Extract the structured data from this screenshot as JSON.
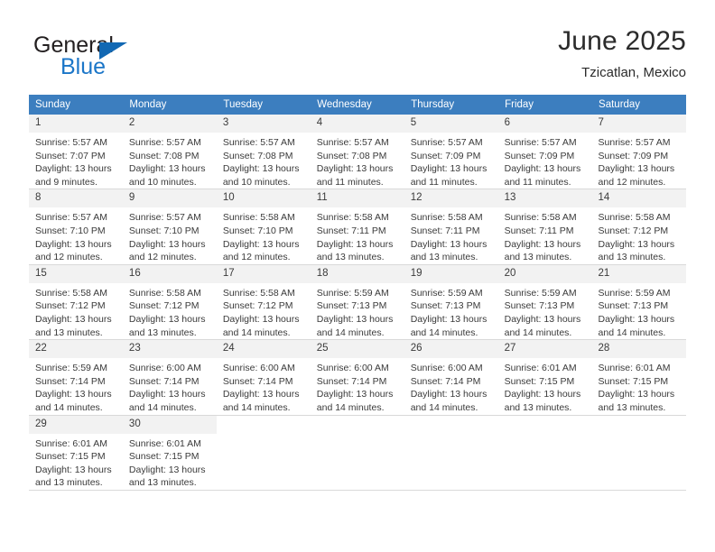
{
  "brand": {
    "name_top": "General",
    "name_bottom": "Blue",
    "accent_color": "#1b76c8",
    "triangle_color": "#1268b3"
  },
  "header": {
    "title": "June 2025",
    "subtitle": "Tzicatlan, Mexico"
  },
  "calendar": {
    "header_bg": "#3c7ebf",
    "weekdays": [
      "Sunday",
      "Monday",
      "Tuesday",
      "Wednesday",
      "Thursday",
      "Friday",
      "Saturday"
    ],
    "weeks": [
      [
        {
          "day": "1",
          "sunrise": "Sunrise: 5:57 AM",
          "sunset": "Sunset: 7:07 PM",
          "daylight_1": "Daylight: 13 hours",
          "daylight_2": "and 9 minutes."
        },
        {
          "day": "2",
          "sunrise": "Sunrise: 5:57 AM",
          "sunset": "Sunset: 7:08 PM",
          "daylight_1": "Daylight: 13 hours",
          "daylight_2": "and 10 minutes."
        },
        {
          "day": "3",
          "sunrise": "Sunrise: 5:57 AM",
          "sunset": "Sunset: 7:08 PM",
          "daylight_1": "Daylight: 13 hours",
          "daylight_2": "and 10 minutes."
        },
        {
          "day": "4",
          "sunrise": "Sunrise: 5:57 AM",
          "sunset": "Sunset: 7:08 PM",
          "daylight_1": "Daylight: 13 hours",
          "daylight_2": "and 11 minutes."
        },
        {
          "day": "5",
          "sunrise": "Sunrise: 5:57 AM",
          "sunset": "Sunset: 7:09 PM",
          "daylight_1": "Daylight: 13 hours",
          "daylight_2": "and 11 minutes."
        },
        {
          "day": "6",
          "sunrise": "Sunrise: 5:57 AM",
          "sunset": "Sunset: 7:09 PM",
          "daylight_1": "Daylight: 13 hours",
          "daylight_2": "and 11 minutes."
        },
        {
          "day": "7",
          "sunrise": "Sunrise: 5:57 AM",
          "sunset": "Sunset: 7:09 PM",
          "daylight_1": "Daylight: 13 hours",
          "daylight_2": "and 12 minutes."
        }
      ],
      [
        {
          "day": "8",
          "sunrise": "Sunrise: 5:57 AM",
          "sunset": "Sunset: 7:10 PM",
          "daylight_1": "Daylight: 13 hours",
          "daylight_2": "and 12 minutes."
        },
        {
          "day": "9",
          "sunrise": "Sunrise: 5:57 AM",
          "sunset": "Sunset: 7:10 PM",
          "daylight_1": "Daylight: 13 hours",
          "daylight_2": "and 12 minutes."
        },
        {
          "day": "10",
          "sunrise": "Sunrise: 5:58 AM",
          "sunset": "Sunset: 7:10 PM",
          "daylight_1": "Daylight: 13 hours",
          "daylight_2": "and 12 minutes."
        },
        {
          "day": "11",
          "sunrise": "Sunrise: 5:58 AM",
          "sunset": "Sunset: 7:11 PM",
          "daylight_1": "Daylight: 13 hours",
          "daylight_2": "and 13 minutes."
        },
        {
          "day": "12",
          "sunrise": "Sunrise: 5:58 AM",
          "sunset": "Sunset: 7:11 PM",
          "daylight_1": "Daylight: 13 hours",
          "daylight_2": "and 13 minutes."
        },
        {
          "day": "13",
          "sunrise": "Sunrise: 5:58 AM",
          "sunset": "Sunset: 7:11 PM",
          "daylight_1": "Daylight: 13 hours",
          "daylight_2": "and 13 minutes."
        },
        {
          "day": "14",
          "sunrise": "Sunrise: 5:58 AM",
          "sunset": "Sunset: 7:12 PM",
          "daylight_1": "Daylight: 13 hours",
          "daylight_2": "and 13 minutes."
        }
      ],
      [
        {
          "day": "15",
          "sunrise": "Sunrise: 5:58 AM",
          "sunset": "Sunset: 7:12 PM",
          "daylight_1": "Daylight: 13 hours",
          "daylight_2": "and 13 minutes."
        },
        {
          "day": "16",
          "sunrise": "Sunrise: 5:58 AM",
          "sunset": "Sunset: 7:12 PM",
          "daylight_1": "Daylight: 13 hours",
          "daylight_2": "and 13 minutes."
        },
        {
          "day": "17",
          "sunrise": "Sunrise: 5:58 AM",
          "sunset": "Sunset: 7:12 PM",
          "daylight_1": "Daylight: 13 hours",
          "daylight_2": "and 14 minutes."
        },
        {
          "day": "18",
          "sunrise": "Sunrise: 5:59 AM",
          "sunset": "Sunset: 7:13 PM",
          "daylight_1": "Daylight: 13 hours",
          "daylight_2": "and 14 minutes."
        },
        {
          "day": "19",
          "sunrise": "Sunrise: 5:59 AM",
          "sunset": "Sunset: 7:13 PM",
          "daylight_1": "Daylight: 13 hours",
          "daylight_2": "and 14 minutes."
        },
        {
          "day": "20",
          "sunrise": "Sunrise: 5:59 AM",
          "sunset": "Sunset: 7:13 PM",
          "daylight_1": "Daylight: 13 hours",
          "daylight_2": "and 14 minutes."
        },
        {
          "day": "21",
          "sunrise": "Sunrise: 5:59 AM",
          "sunset": "Sunset: 7:13 PM",
          "daylight_1": "Daylight: 13 hours",
          "daylight_2": "and 14 minutes."
        }
      ],
      [
        {
          "day": "22",
          "sunrise": "Sunrise: 5:59 AM",
          "sunset": "Sunset: 7:14 PM",
          "daylight_1": "Daylight: 13 hours",
          "daylight_2": "and 14 minutes."
        },
        {
          "day": "23",
          "sunrise": "Sunrise: 6:00 AM",
          "sunset": "Sunset: 7:14 PM",
          "daylight_1": "Daylight: 13 hours",
          "daylight_2": "and 14 minutes."
        },
        {
          "day": "24",
          "sunrise": "Sunrise: 6:00 AM",
          "sunset": "Sunset: 7:14 PM",
          "daylight_1": "Daylight: 13 hours",
          "daylight_2": "and 14 minutes."
        },
        {
          "day": "25",
          "sunrise": "Sunrise: 6:00 AM",
          "sunset": "Sunset: 7:14 PM",
          "daylight_1": "Daylight: 13 hours",
          "daylight_2": "and 14 minutes."
        },
        {
          "day": "26",
          "sunrise": "Sunrise: 6:00 AM",
          "sunset": "Sunset: 7:14 PM",
          "daylight_1": "Daylight: 13 hours",
          "daylight_2": "and 14 minutes."
        },
        {
          "day": "27",
          "sunrise": "Sunrise: 6:01 AM",
          "sunset": "Sunset: 7:15 PM",
          "daylight_1": "Daylight: 13 hours",
          "daylight_2": "and 13 minutes."
        },
        {
          "day": "28",
          "sunrise": "Sunrise: 6:01 AM",
          "sunset": "Sunset: 7:15 PM",
          "daylight_1": "Daylight: 13 hours",
          "daylight_2": "and 13 minutes."
        }
      ],
      [
        {
          "day": "29",
          "sunrise": "Sunrise: 6:01 AM",
          "sunset": "Sunset: 7:15 PM",
          "daylight_1": "Daylight: 13 hours",
          "daylight_2": "and 13 minutes."
        },
        {
          "day": "30",
          "sunrise": "Sunrise: 6:01 AM",
          "sunset": "Sunset: 7:15 PM",
          "daylight_1": "Daylight: 13 hours",
          "daylight_2": "and 13 minutes."
        },
        null,
        null,
        null,
        null,
        null
      ]
    ]
  }
}
